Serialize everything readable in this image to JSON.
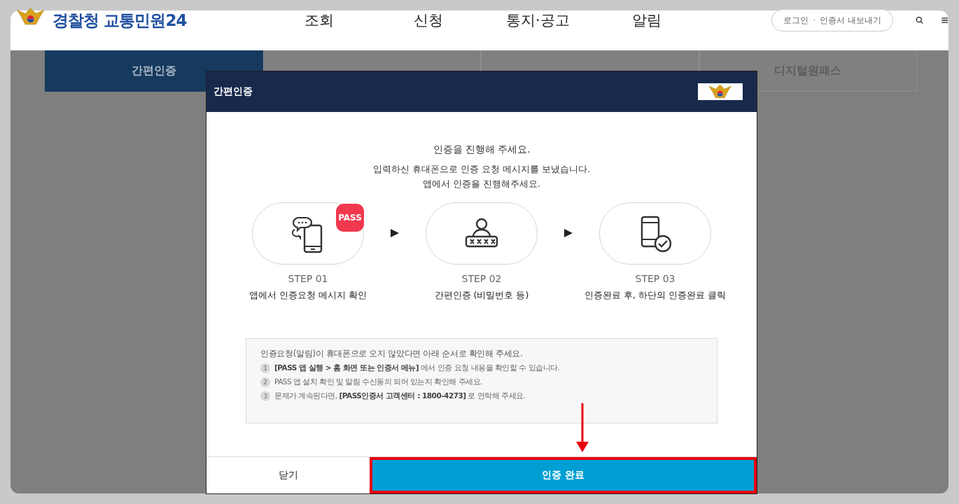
{
  "header": {
    "logo_text": "경찰청 교통민원24",
    "nav": [
      {
        "label": "조회"
      },
      {
        "label": "신청"
      },
      {
        "label": "통지·공고"
      },
      {
        "label": "알림"
      }
    ],
    "account_links": [
      "로그인",
      "인증서 내보내기"
    ],
    "account_separator": "·"
  },
  "tabs": [
    {
      "label": "간편인증",
      "selected": true
    },
    {
      "selected": false
    },
    {
      "selected": false
    },
    {
      "label": "디지털원패스",
      "selected": false
    }
  ],
  "modal": {
    "title": "간편인증",
    "heading": "인증을 진행해 주세요.",
    "message": [
      "입력하신 휴대폰으로 인증 요청 메시지를 보냈습니다.",
      "앱에서 인증을 진행해주세요."
    ],
    "steps": [
      {
        "kind": "message",
        "step": "STEP 01",
        "label": "앱에서 인증요청 메시지 확인",
        "badge": "PASS"
      },
      {
        "kind": "password",
        "step": "STEP 02",
        "label": "간편인증 (비밀번호 등)"
      },
      {
        "kind": "done",
        "step": "STEP 03",
        "label": "인증완료 후, 하단의 인증완료 클릭"
      }
    ],
    "notice": {
      "intro": "인증요청(알림)이 휴대폰으로 오지 않았다면 아래 순서로 확인해 주세요.",
      "items": [
        {
          "number": "1",
          "text": "**[PASS 앱 실행 > 홈 화면 또는 인증서 메뉴]** 에서 인증 요청 내용을 확인할 수 있습니다."
        },
        {
          "number": "2",
          "text": "PASS 앱 설치 확인 및 알림 수신동의 되어 있는지 확인해 주세요."
        },
        {
          "number": "3",
          "text": "문제가 계속된다면, **[PASS인증서 고객센터 : 1800-4273]** 로 연락해 주세요."
        }
      ]
    },
    "buttons": [
      {
        "label": "닫기",
        "kind": "close",
        "highlighted": false
      },
      {
        "label": "인증 완료",
        "kind": "confirm",
        "highlighted": true
      }
    ]
  }
}
